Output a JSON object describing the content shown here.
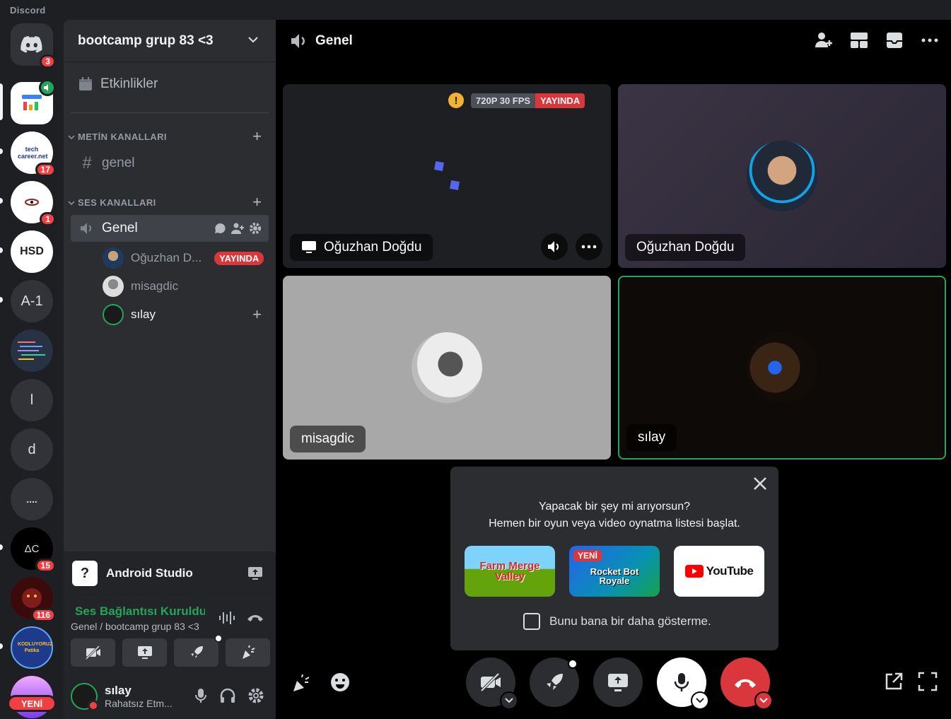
{
  "app": {
    "title": "Discord"
  },
  "rail": {
    "home_badge": "3",
    "servers": [
      {
        "label": "",
        "badge": ""
      },
      {
        "label": "tech career.net",
        "badge": "17"
      },
      {
        "label": "",
        "badge": "1"
      },
      {
        "label": "HSD",
        "badge": ""
      },
      {
        "label": "A-1",
        "badge": ""
      },
      {
        "label": "",
        "badge": ""
      },
      {
        "label": "l",
        "badge": ""
      },
      {
        "label": "d",
        "badge": ""
      },
      {
        "label": "....",
        "badge": ""
      },
      {
        "label": "ΔC",
        "badge": "15"
      },
      {
        "label": "",
        "badge": "116"
      },
      {
        "label": "KODLUYORUZ Patika",
        "badge": ""
      }
    ],
    "new_badge": "YENİ"
  },
  "sidebar": {
    "guild_name": "bootcamp grup 83 <3",
    "events_label": "Etkinlikler",
    "text_category": "METİN KANALLARI",
    "text_channels": [
      "genel"
    ],
    "voice_category": "SES KANALLARI",
    "voice_channel": "Genel",
    "members": [
      {
        "name": "Oğuzhan D...",
        "badge": "YAYINDA"
      },
      {
        "name": "misagdic",
        "badge": ""
      },
      {
        "name": "sılay",
        "badge": ""
      }
    ],
    "activity": {
      "icon": "?",
      "name": "Android Studio"
    },
    "voice_status": "Ses Bağlantısı Kuruldu",
    "voice_sub": "Genel / bootcamp grup 83 <3",
    "user": {
      "name": "sılay",
      "status": "Rahatsız Etm..."
    }
  },
  "main": {
    "channel_title": "Genel",
    "tiles": [
      {
        "label": "Oğuzhan Doğdu",
        "quality": "720P 30 FPS",
        "live": "YAYINDA",
        "warning": "!"
      },
      {
        "label": "Oğuzhan Doğdu"
      },
      {
        "label": "misagdic"
      },
      {
        "label": "sılay"
      }
    ],
    "popup": {
      "line1": "Yapacak bir şey mi arıyorsun?",
      "line2": "Hemen bir oyun veya video oynatma listesi başlat.",
      "cards": [
        "Farm Merge Valley",
        "Rocket Bot Royale",
        "YouTube"
      ],
      "new_tag": "YENİ",
      "checkbox_label": "Bunu bana bir daha gösterme."
    }
  },
  "colors": {
    "accent": "#5865f2",
    "green": "#23a55a",
    "red": "#da373c",
    "bg": "#1e1f22"
  }
}
